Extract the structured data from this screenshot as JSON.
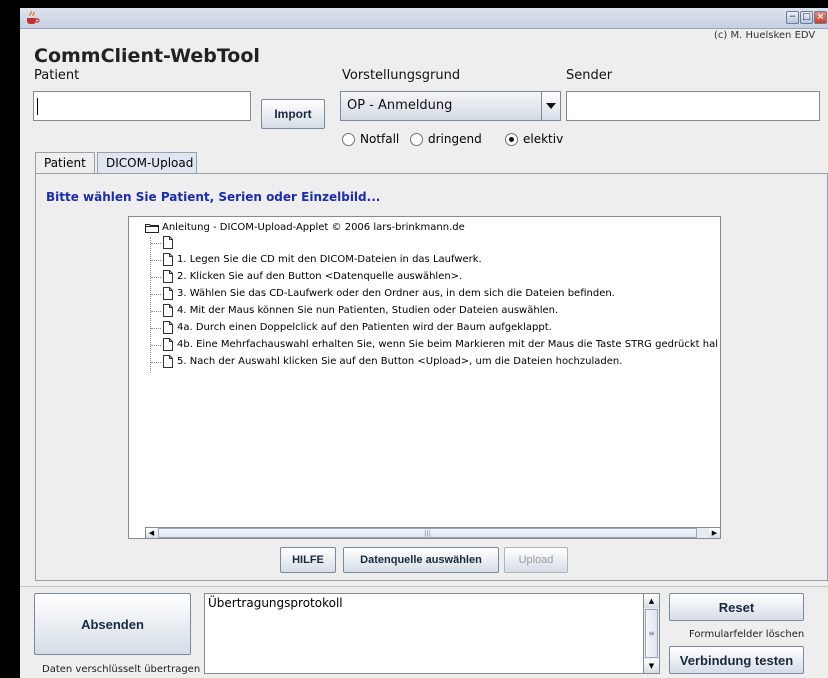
{
  "window": {
    "copyright": "(c) M. Huelsken EDV",
    "controls": {
      "minimize": "−",
      "maximize": "□",
      "close": "×"
    }
  },
  "app": {
    "title": "CommClient-WebTool"
  },
  "form": {
    "patient_label": "Patient",
    "patient_value": "",
    "import_label": "Import",
    "reason_label": "Vorstellungsgrund",
    "reason_value": "OP - Anmeldung",
    "sender_label": "Sender",
    "sender_value": "",
    "priority": {
      "options": [
        "Notfall",
        "dringend",
        "elektiv"
      ],
      "selected": "elektiv"
    }
  },
  "tabs": [
    {
      "label": "Patient",
      "active": false
    },
    {
      "label": "DICOM-Upload",
      "active": true
    }
  ],
  "dicom": {
    "hint": "Bitte wählen Sie Patient, Serien oder Einzelbild...",
    "tree_root": "Anleitung - DICOM-Upload-Applet © 2006 lars-brinkmann.de",
    "tree_items": [
      "",
      "1. Legen Sie die CD mit den DICOM-Dateien in das Laufwerk.",
      "2. Klicken Sie auf den Button <Datenquelle auswählen>.",
      "3. Wählen Sie das CD-Laufwerk oder den Ordner aus, in dem sich die Dateien befinden.",
      "4. Mit der Maus können Sie nun Patienten, Studien oder Dateien auswählen.",
      "4a. Durch einen Doppelclick auf den Patienten wird der Baum aufgeklappt.",
      "4b. Eine Mehrfachauswahl erhalten Sie, wenn Sie beim Markieren mit der Maus die Taste STRG gedrückt hal",
      "5. Nach der Auswahl klicken Sie auf den Button <Upload>, um die Dateien hochzuladen."
    ],
    "buttons": {
      "help": "HILFE",
      "choose_source": "Datenquelle auswählen",
      "upload": "Upload"
    }
  },
  "footer": {
    "send_label": "Absenden",
    "send_note": "Daten verschlüsselt übertragen",
    "protocol_text": "Übertragungsprotokoll",
    "reset_label": "Reset",
    "reset_note": "Formularfelder löschen",
    "test_label": "Verbindung testen"
  },
  "colors": {
    "hint_text": "#1c2cb0",
    "background": "#eeeeee"
  }
}
